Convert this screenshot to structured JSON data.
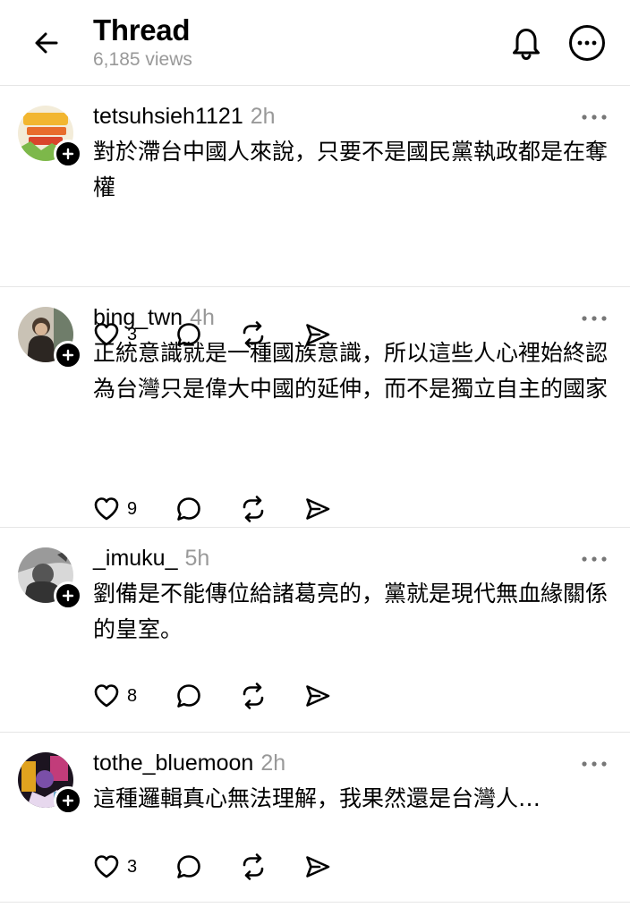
{
  "header": {
    "title": "Thread",
    "views": "6,185 views"
  },
  "icons": {
    "back": "arrow-left-icon",
    "notifications": "bell-icon",
    "more": "more-circle-icon",
    "like": "heart-icon",
    "reply": "comment-icon",
    "repost": "repost-icon",
    "share": "send-icon",
    "follow": "plus-icon"
  },
  "posts": [
    {
      "username": "tetsuhsieh1121",
      "time": "2h",
      "text": "對於滯台中國人來說，只要不是國民黨執政都是在奪權",
      "likes": "3"
    },
    {
      "username": "bing_twn",
      "time": "4h",
      "text": "正統意識就是一種國族意識，所以這些人心裡始終認為台灣只是偉大中國的延伸，而不是獨立自主的國家",
      "likes": "9"
    },
    {
      "username": "_imuku_",
      "time": "5h",
      "text": "劉備是不能傳位給諸葛亮的，黨就是現代無血緣關係的皇室。",
      "likes": "8"
    },
    {
      "username": "tothe_bluemoon",
      "time": "2h",
      "text": "這種邏輯真心無法理解，我果然還是台灣人…",
      "likes": "3"
    }
  ],
  "colors": {
    "text": "#000000",
    "muted": "#999999",
    "divider": "#e6e6e6",
    "background": "#ffffff"
  }
}
